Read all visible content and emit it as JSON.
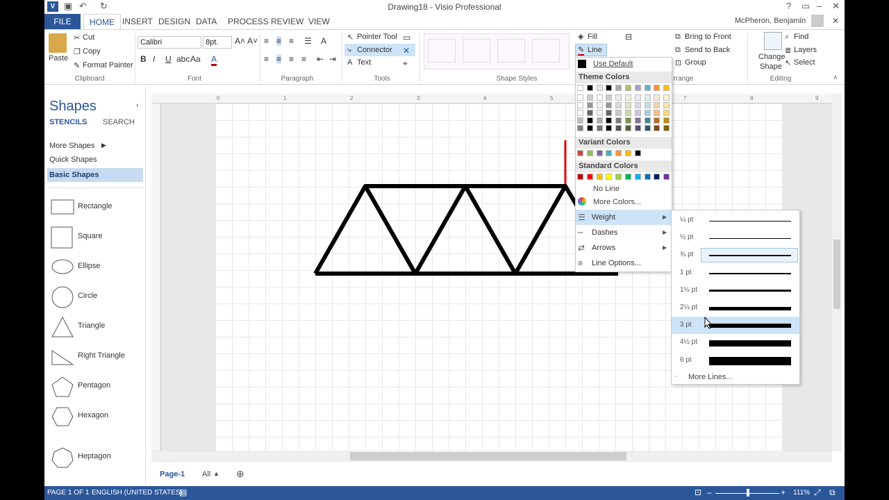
{
  "window": {
    "title": "Drawing18 - Visio Professional",
    "user": "McPheron, Benjamin"
  },
  "tabs": [
    "FILE",
    "HOME",
    "INSERT",
    "DESIGN",
    "DATA",
    "PROCESS",
    "REVIEW",
    "VIEW"
  ],
  "ribbon": {
    "clipboard": {
      "paste": "Paste",
      "cut": "Cut",
      "copy": "Copy",
      "format_painter": "Format Painter",
      "label": "Clipboard"
    },
    "font": {
      "name": "Calibri",
      "size": "8pt.",
      "label": "Font"
    },
    "paragraph": {
      "label": "Paragraph"
    },
    "tools": {
      "pointer": "Pointer Tool",
      "connector": "Connector",
      "text": "Text",
      "label": "Tools"
    },
    "shape_styles": {
      "label": "Shape Styles",
      "fill": "Fill",
      "line": "Line"
    },
    "arrange": {
      "bring_to_front": "Bring to Front",
      "send_to_back": "Send to Back",
      "group": "Group",
      "label": "rrange"
    },
    "editing": {
      "change_shape": "Change",
      "change_shape2": "Shape",
      "find": "Find",
      "layers": "Layers",
      "select": "Select",
      "label": "Editing"
    }
  },
  "shapes_pane": {
    "title": "Shapes",
    "tab_stencils": "STENCILS",
    "tab_search": "SEARCH",
    "more_shapes": "More Shapes",
    "quick_shapes": "Quick Shapes",
    "basic_shapes": "Basic Shapes",
    "items": [
      "Rectangle",
      "Square",
      "Ellipse",
      "Circle",
      "Triangle",
      "Right Triangle",
      "Pentagon",
      "Hexagon",
      "Heptagon"
    ]
  },
  "ruler_h": [
    "0",
    "1",
    "2",
    "3",
    "4",
    "5",
    "6",
    "7",
    "8",
    "9"
  ],
  "line_menu": {
    "use_default": "Use Default",
    "theme_colors": "Theme Colors",
    "variant_colors": "Variant Colors",
    "standard_colors": "Standard Colors",
    "no_line": "No Line",
    "more_colors": "More Colors...",
    "weight": "Weight",
    "dashes": "Dashes",
    "arrows": "Arrows",
    "line_options": "Line Options..."
  },
  "theme_top": [
    "#ffffff",
    "#000000",
    "#e7e6e6",
    "#000000",
    "#a5a5a5",
    "#a9c26b",
    "#b09bcb",
    "#5bb5c4",
    "#f0913c",
    "#f5c020"
  ],
  "variant_colors": [
    "#c0504d",
    "#9bbb59",
    "#8064a2",
    "#4bacc6",
    "#f79646",
    "#ffc000",
    "#000000"
  ],
  "standard_colors": [
    "#c00000",
    "#ff0000",
    "#ffc000",
    "#ffff00",
    "#92d050",
    "#00b050",
    "#00b0f0",
    "#0070c0",
    "#002060",
    "#7030a0"
  ],
  "weight_menu": {
    "items": [
      "¼ pt",
      "½ pt",
      "¾ pt",
      "1 pt",
      "1½ pt",
      "2¼ pt",
      "3 pt",
      "4½ pt",
      "6 pt"
    ],
    "thickness": [
      0.25,
      0.5,
      0.75,
      1,
      1.5,
      2.25,
      3,
      4.5,
      6
    ],
    "more_lines": "More Lines..."
  },
  "page_tabs": {
    "page": "Page-1",
    "all": "All"
  },
  "status": {
    "page": "PAGE 1 OF 1",
    "language": "ENGLISH (UNITED STATES)",
    "zoom": "111%"
  }
}
